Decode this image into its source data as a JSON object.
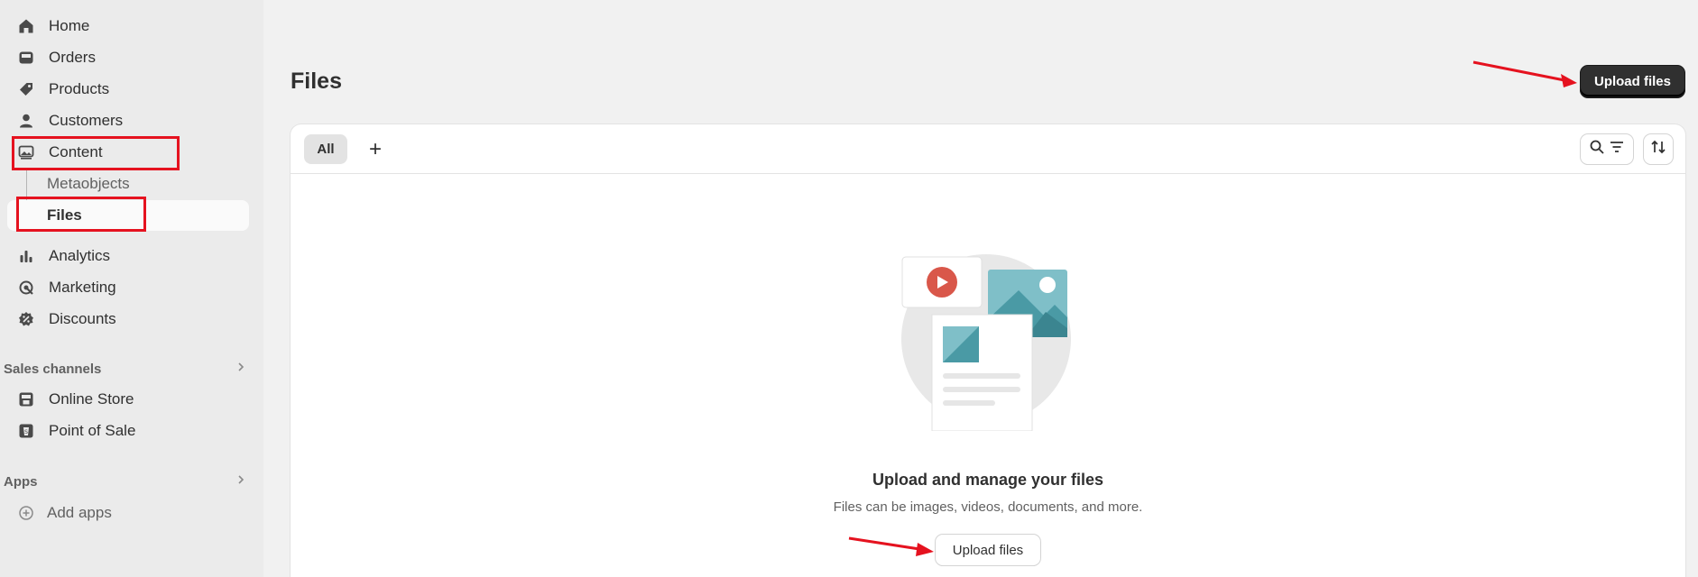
{
  "sidebar": {
    "items": [
      {
        "label": "Home",
        "icon": "home-icon"
      },
      {
        "label": "Orders",
        "icon": "inbox-icon"
      },
      {
        "label": "Products",
        "icon": "tag-icon"
      },
      {
        "label": "Customers",
        "icon": "person-icon"
      },
      {
        "label": "Content",
        "icon": "image-icon"
      },
      {
        "label": "Metaobjects"
      },
      {
        "label": "Files"
      },
      {
        "label": "Analytics",
        "icon": "bar-chart-icon"
      },
      {
        "label": "Marketing",
        "icon": "target-icon"
      },
      {
        "label": "Discounts",
        "icon": "discount-icon"
      }
    ],
    "sales_channels": {
      "heading": "Sales channels",
      "items": [
        {
          "label": "Online Store",
          "icon": "store-icon"
        },
        {
          "label": "Point of Sale",
          "icon": "pos-icon"
        }
      ]
    },
    "apps": {
      "heading": "Apps",
      "items": [
        {
          "label": "Add apps",
          "icon": "plus-circle-icon"
        }
      ]
    }
  },
  "header": {
    "title": "Files",
    "upload_button": "Upload files"
  },
  "card": {
    "tabs": [
      {
        "label": "All"
      }
    ],
    "add_tab": "+",
    "empty_state": {
      "title": "Upload and manage your files",
      "subtitle": "Files can be images, videos, documents, and more.",
      "button": "Upload files"
    }
  },
  "colors": {
    "highlight": "#e5121f",
    "primary_button": "#303030",
    "sidebar_bg": "#ebebeb",
    "page_bg": "#f1f1f1",
    "illustration_teal": "#4a9aa5",
    "illustration_red": "#d9574a"
  }
}
